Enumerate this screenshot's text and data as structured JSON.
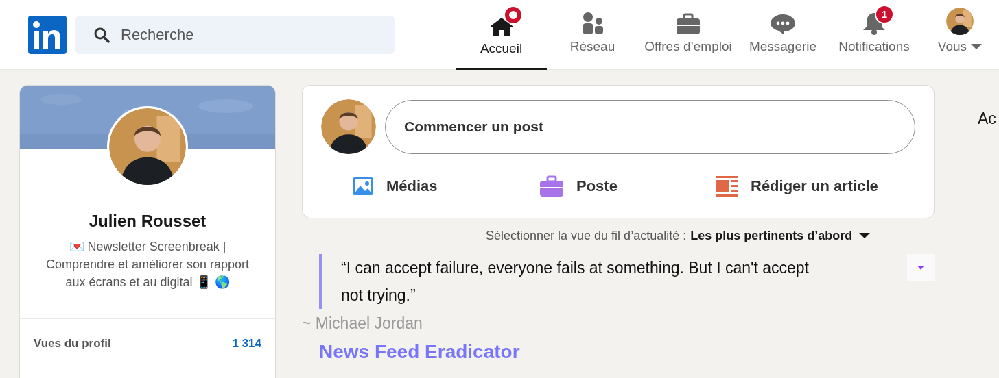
{
  "header": {
    "search": {
      "placeholder": "Recherche"
    },
    "nav": [
      {
        "kind": "home",
        "label": "Accueil",
        "selected": true,
        "badge": {
          "kind": "dot"
        }
      },
      {
        "kind": "network",
        "label": "Réseau",
        "selected": false
      },
      {
        "kind": "jobs",
        "label": "Offres d’emploi",
        "selected": false
      },
      {
        "kind": "messaging",
        "label": "Messagerie",
        "selected": false
      },
      {
        "kind": "notifications",
        "label": "Notifications",
        "selected": false,
        "badge": {
          "kind": "count",
          "text": "1"
        }
      },
      {
        "kind": "me",
        "label": "Vous",
        "selected": false
      }
    ]
  },
  "profile": {
    "name": "Julien Rousset",
    "headline": "💌 Newsletter Screenbreak | Comprendre et améliorer son rapport aux écrans et au digital 📱 🌎",
    "stats": [
      {
        "label": "Vues du profil",
        "value": "1 314"
      }
    ]
  },
  "composer": {
    "start_post": "Commencer un post",
    "actions": [
      {
        "kind": "media",
        "label": "Médias"
      },
      {
        "kind": "job",
        "label": "Poste"
      },
      {
        "kind": "article",
        "label": "Rédiger un article"
      }
    ]
  },
  "sort": {
    "label": "Sélectionner la vue du fil d’actualité :",
    "value": "Les plus pertinents d’abord"
  },
  "quote": {
    "text": "“I can accept failure, everyone fails at something. But I can't accept not trying.”",
    "author": "~ Michael Jordan",
    "credit": "News Feed Eradicator"
  },
  "right_column": {
    "heading": "Ac"
  }
}
